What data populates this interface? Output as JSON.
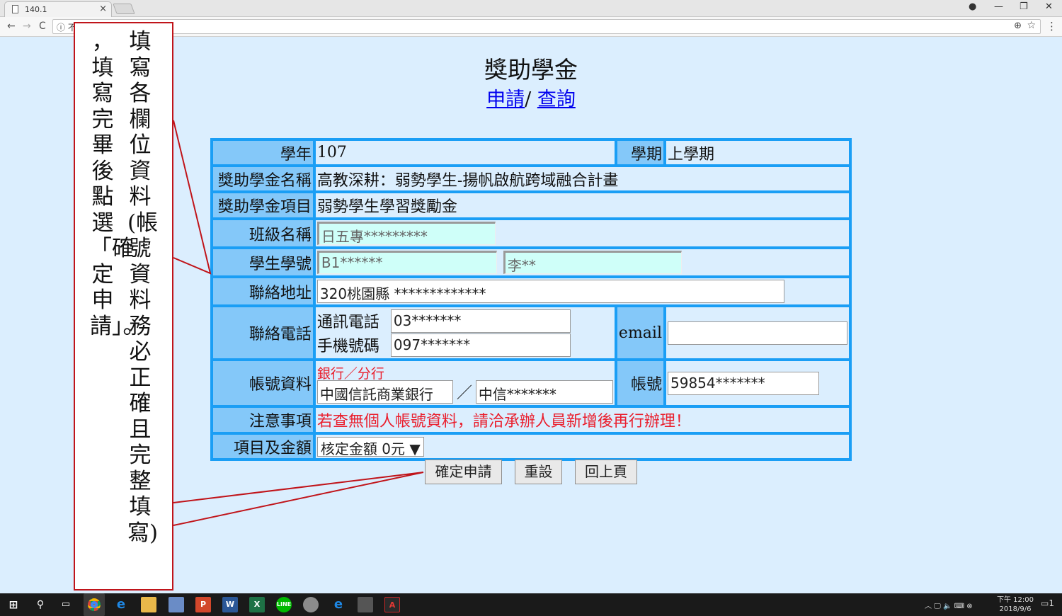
{
  "browser": {
    "tab_title": "140.1",
    "tab_close": "×",
    "address_info": "ⓘ 不",
    "nav": {
      "back": "←",
      "forward": "→",
      "reload": "C"
    },
    "window": {
      "account": "●",
      "minimize": "—",
      "restore": "❐",
      "close": "✕"
    }
  },
  "page": {
    "title": "獎助學金",
    "link_apply": "申請",
    "link_sep": "/",
    "link_query": "查詢"
  },
  "form": {
    "year_label": "學年",
    "year_value": "107",
    "semester_label": "學期",
    "semester_value": "上學期",
    "name_label": "獎助學金名稱",
    "name_value": "高教深耕：弱勢學生-揚帆啟航跨域融合計畫",
    "item_label": "獎助學金項目",
    "item_value": "弱勢學生學習獎勵金",
    "class_label": "班級名稱",
    "class_value": "日五專*********",
    "student_label": "學生學號",
    "student_id": "B1******",
    "student_name": "李**",
    "address_label": "聯絡地址",
    "address_value": "320桃園縣 *************",
    "phone_label": "聯絡電話",
    "tel_label": "通訊電話",
    "tel_value": "03*******",
    "mobile_label": "手機號碼",
    "mobile_value": "097*******",
    "email_label": "email",
    "email_value": "",
    "bank_label": "帳號資料",
    "bank_hint": "銀行／分行",
    "bank_value": "中國信託商業銀行",
    "bank_sep": "／",
    "branch_value": "中信*******",
    "account_label": "帳號",
    "account_value": "59854*******",
    "note_label": "注意事項",
    "note_value": "若查無個人帳號資料，請洽承辦人員新增後再行辦理！",
    "amount_label": "項目及金額",
    "amount_value": "核定金額 0元 ▼"
  },
  "buttons": {
    "confirm": "確定申請",
    "reset": "重設",
    "back": "回上頁"
  },
  "callout": {
    "line1": "填寫各欄位資料(帳號資料務必正確且完整填寫)",
    "line2": "，填寫完畢後點選「確定申請」。"
  },
  "taskbar": {
    "time": "下午 12:00",
    "date": "2018/9/6",
    "notification_count": "1"
  },
  "colors": {
    "page_bg": "#dbeefe",
    "label_bg": "#84c8f9",
    "border": "#1a9ef5",
    "field_bg": "#cffff9",
    "warning": "#ea1f2d",
    "callout_border": "#c0141a"
  }
}
